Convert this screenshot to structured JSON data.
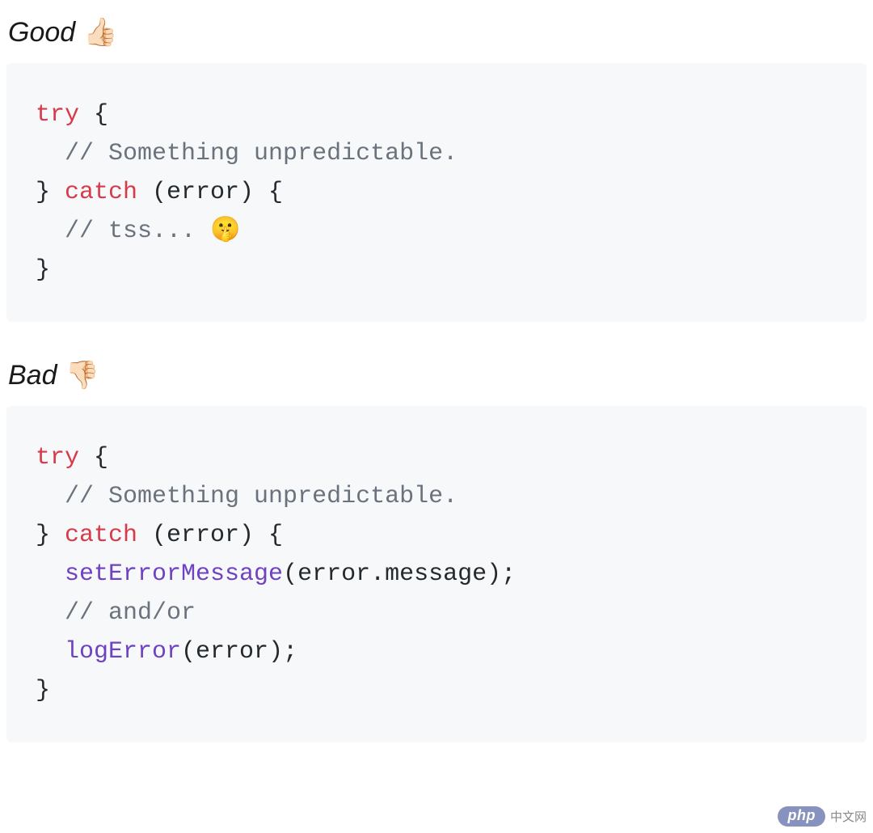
{
  "sections": {
    "good": {
      "label": "Good",
      "emoji": "👍🏻",
      "code": {
        "l1_try": "try",
        "l1_rest": " {",
        "l2_comment": "// Something unpredictable.",
        "l3_brace": "} ",
        "l3_catch": "catch",
        "l3_rest": " (error) {",
        "l4_comment": "// tss... 🤫",
        "l5": "}"
      }
    },
    "bad": {
      "label": "Bad",
      "emoji": "👎🏻",
      "code": {
        "l1_try": "try",
        "l1_rest": " {",
        "l2_comment": "// Something unpredictable.",
        "l3_brace": "} ",
        "l3_catch": "catch",
        "l3_rest": " (error) {",
        "l4_fn": "setErrorMessage",
        "l4_rest": "(error.message);",
        "l5_comment": "// and/or",
        "l6_fn": "logError",
        "l6_rest": "(error);",
        "l7": "}"
      }
    }
  },
  "watermark": {
    "badge": "php",
    "text": "中文网"
  },
  "indent": "  "
}
